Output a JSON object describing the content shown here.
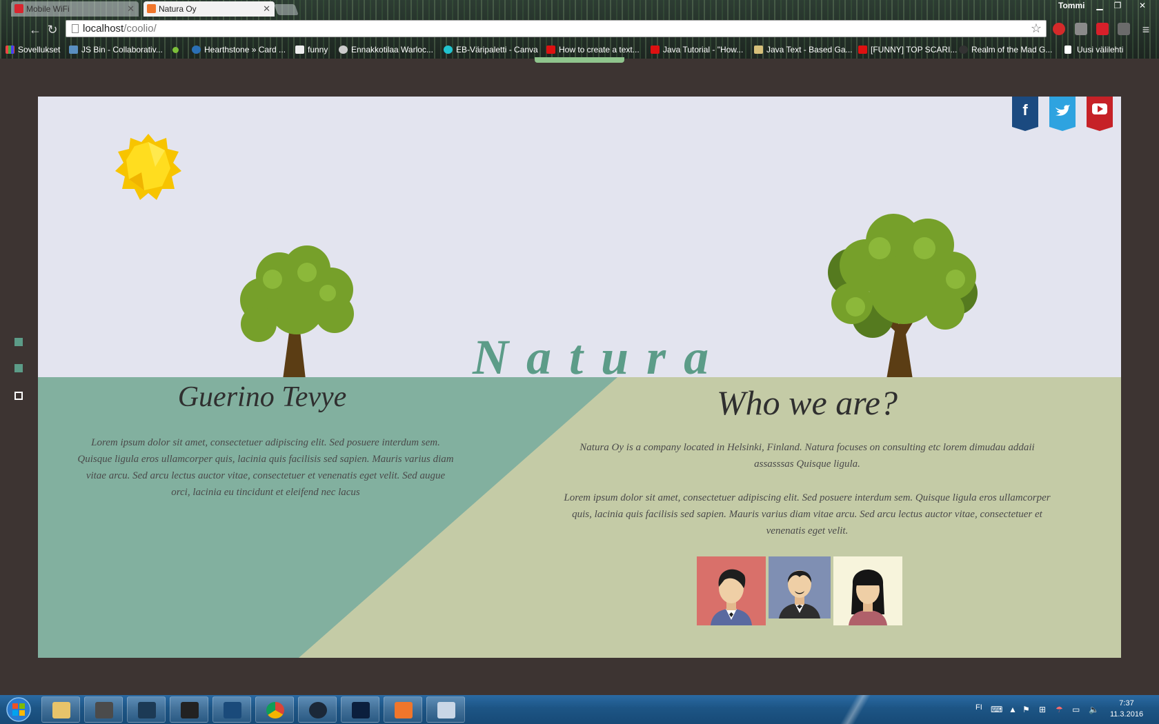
{
  "browser": {
    "tabs": [
      {
        "title": "Mobile WiFi",
        "active": false,
        "icon": "huawei-icon"
      },
      {
        "title": "Natura Oy",
        "active": true,
        "icon": "xampp-icon"
      }
    ],
    "user": "Tommi",
    "url_host": "localhost",
    "url_path": "/coolio/",
    "bookmarks": [
      "Sovellukset",
      "JS Bin - Collaborativ...",
      "Hearthstone » Card ...",
      "funny",
      "Ennakkotilaa Warloc...",
      "EB-Väripaletti - Canva",
      "How to create a text...",
      "Java Tutorial - \"How...",
      "Java Text - Based Ga...",
      "[FUNNY] TOP SCARI...",
      "Realm of the Mad G...",
      "Uusi välilehti"
    ]
  },
  "page": {
    "brand": "Natura",
    "left": {
      "title": "Guerino Tevye",
      "text": "Lorem ipsum dolor sit amet, consectetuer adipiscing elit. Sed posuere interdum sem. Quisque ligula eros ullamcorper quis, lacinia quis facilisis sed sapien. Mauris varius diam vitae arcu. Sed arcu lectus auctor vitae, consectetuer et venenatis eget velit. Sed augue orci, lacinia eu tincidunt et eleifend nec lacus"
    },
    "right": {
      "title": "Who we are?",
      "text1": "Natura Oy is a company located in Helsinki, Finland. Natura focuses on consulting etc lorem dimudau addaii assasssas Quisque ligula.",
      "text2": "Lorem ipsum dolor sit amet, consectetuer adipiscing elit. Sed posuere interdum sem. Quisque ligula eros ullamcorper quis, lacinia quis facilisis sed sapien. Mauris varius diam vitae arcu. Sed arcu lectus auctor vitae, consectetuer et venenatis eget velit."
    },
    "social": [
      "facebook-icon",
      "twitter-icon",
      "youtube-icon"
    ],
    "colors": {
      "sky": "#e3e4ef",
      "teal": "#82b09f",
      "olive": "#c4cba6",
      "brand": "#5c9c88",
      "frame": "#3d3432"
    }
  },
  "taskbar": {
    "lang": "FI",
    "time": "7:37",
    "date": "11.3.2016"
  }
}
